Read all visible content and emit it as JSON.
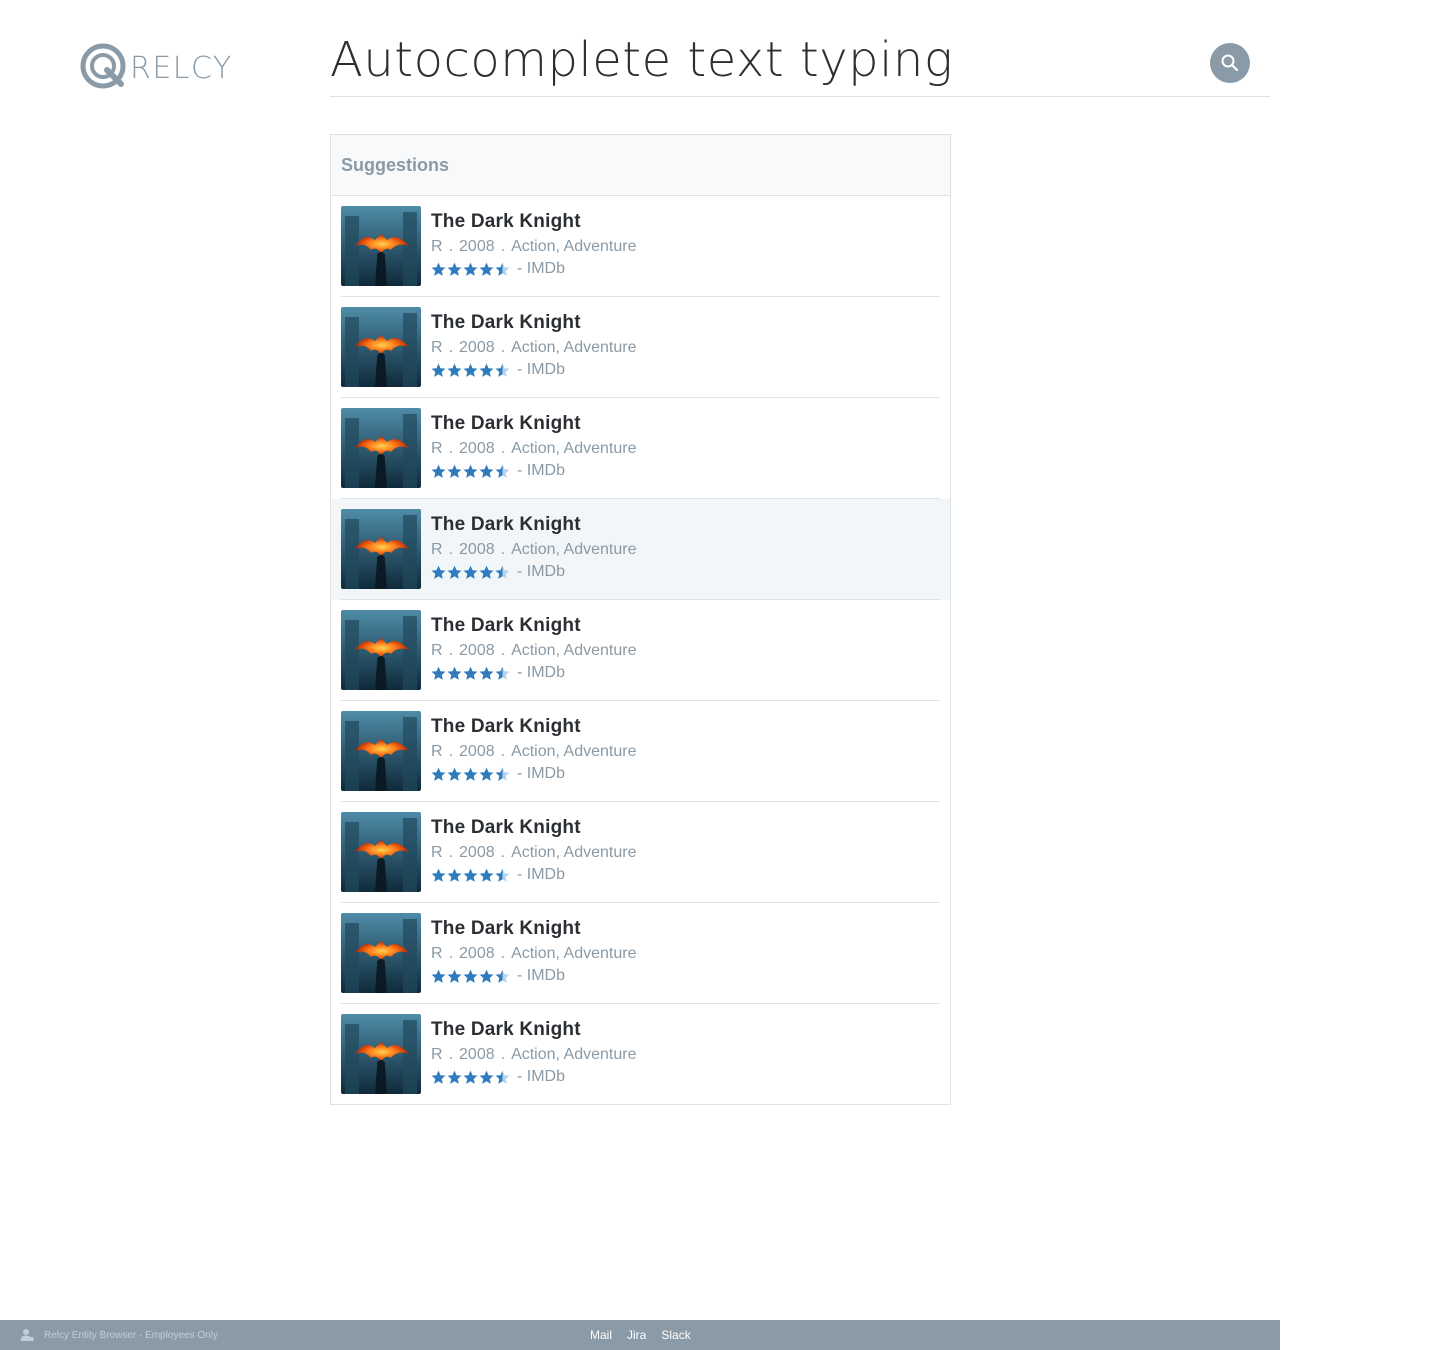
{
  "brand": {
    "logo_text": "RELCY",
    "logo_icon": "relcy-q-icon",
    "logo_color": "#8a9aa6"
  },
  "search": {
    "value": "Autocomplete text typing",
    "placeholder": "",
    "button_icon": "search-icon",
    "button_color": "#8a9aa6"
  },
  "suggestions": {
    "header": "Suggestions",
    "highlighted_index": 3,
    "star_color": "#2f7bbf",
    "items": [
      {
        "title": "The Dark Knight",
        "rating_label": "R",
        "year": "2008",
        "genres": "Action, Adventure",
        "stars": 4.5,
        "source": "- IMDb",
        "poster_icon": "movie-poster-icon"
      },
      {
        "title": "The Dark Knight",
        "rating_label": "R",
        "year": "2008",
        "genres": "Action, Adventure",
        "stars": 4.5,
        "source": "- IMDb",
        "poster_icon": "movie-poster-icon"
      },
      {
        "title": "The Dark Knight",
        "rating_label": "R",
        "year": "2008",
        "genres": "Action, Adventure",
        "stars": 4.5,
        "source": "- IMDb",
        "poster_icon": "movie-poster-icon"
      },
      {
        "title": "The Dark Knight",
        "rating_label": "R",
        "year": "2008",
        "genres": "Action, Adventure",
        "stars": 4.5,
        "source": "- IMDb",
        "poster_icon": "movie-poster-icon"
      },
      {
        "title": "The Dark Knight",
        "rating_label": "R",
        "year": "2008",
        "genres": "Action, Adventure",
        "stars": 4.5,
        "source": "- IMDb",
        "poster_icon": "movie-poster-icon"
      },
      {
        "title": "The Dark Knight",
        "rating_label": "R",
        "year": "2008",
        "genres": "Action, Adventure",
        "stars": 4.5,
        "source": "- IMDb",
        "poster_icon": "movie-poster-icon"
      },
      {
        "title": "The Dark Knight",
        "rating_label": "R",
        "year": "2008",
        "genres": "Action, Adventure",
        "stars": 4.5,
        "source": "- IMDb",
        "poster_icon": "movie-poster-icon"
      },
      {
        "title": "The Dark Knight",
        "rating_label": "R",
        "year": "2008",
        "genres": "Action, Adventure",
        "stars": 4.5,
        "source": "- IMDb",
        "poster_icon": "movie-poster-icon"
      },
      {
        "title": "The Dark Knight",
        "rating_label": "R",
        "year": "2008",
        "genres": "Action, Adventure",
        "stars": 4.5,
        "source": "- IMDb",
        "poster_icon": "movie-poster-icon"
      }
    ]
  },
  "footer": {
    "icon": "user-icon",
    "label": "Relcy Entity Browser - Employees Only",
    "links": [
      "Mail",
      "Jira",
      "Slack"
    ],
    "background": "#8a9aa6"
  }
}
